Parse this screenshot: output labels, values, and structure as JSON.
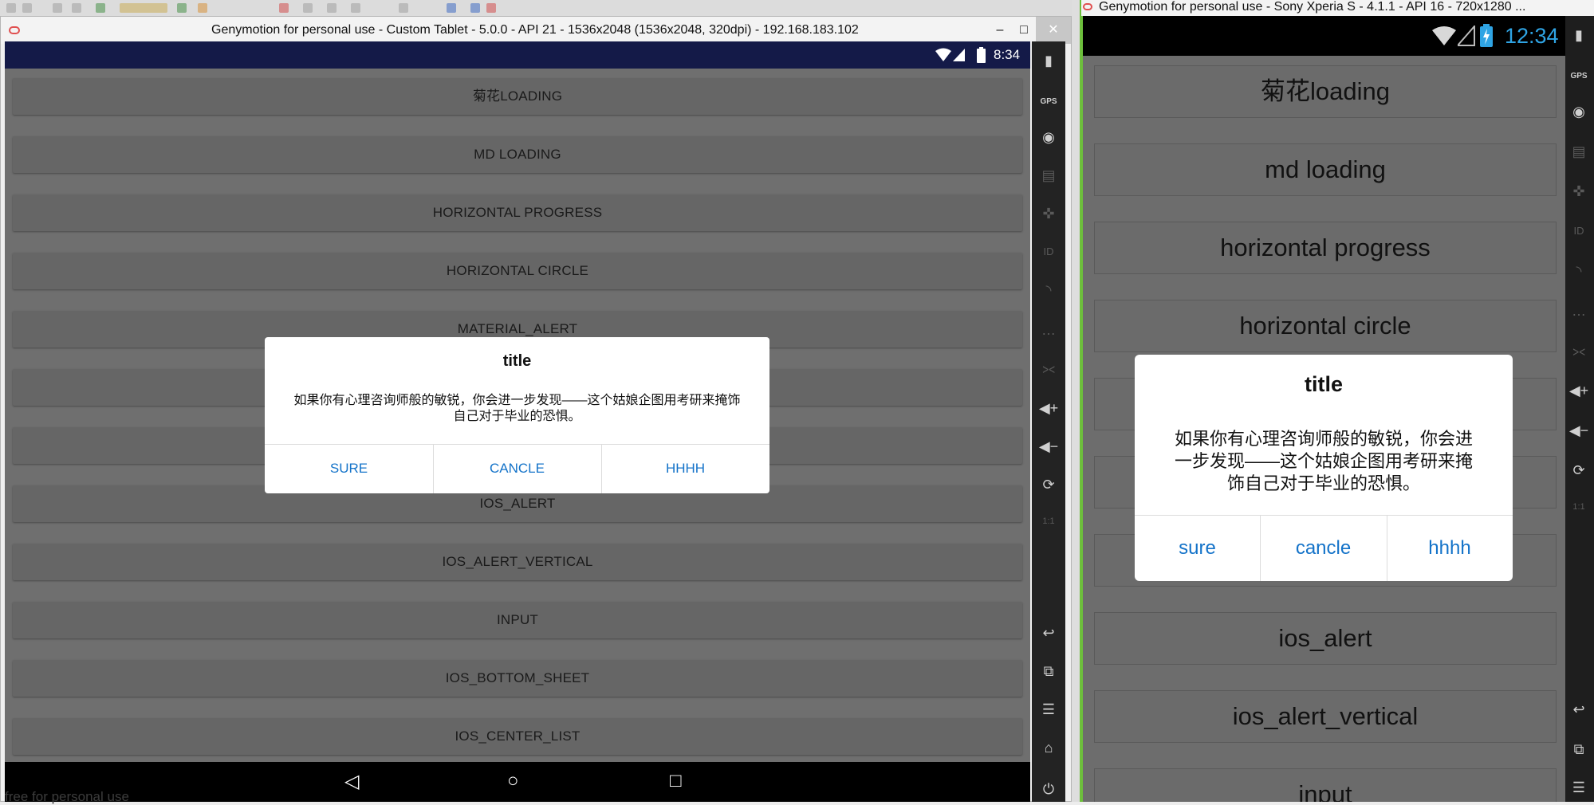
{
  "left_window": {
    "title": "Genymotion for personal use - Custom Tablet - 5.0.0 - API 21 - 1536x2048 (1536x2048, 320dpi) - 192.168.183.102",
    "controls": {
      "minimize": "–",
      "maximize": "□",
      "close": "✕"
    },
    "status_bar": {
      "time": "8:34"
    },
    "buttons": [
      "菊花LOADING",
      "MD LOADING",
      "HORIZONTAL PROGRESS",
      "HORIZONTAL CIRCLE",
      "MATERIAL_ALERT",
      "",
      "",
      "IOS_ALERT",
      "IOS_ALERT_VERTICAL",
      "INPUT",
      "IOS_BOTTOM_SHEET",
      "IOS_CENTER_LIST"
    ],
    "dialog": {
      "title": "title",
      "message": "如果你有心理咨询师般的敏锐，你会进一步发现——这个姑娘企图用考研来掩饰自己对于毕业的恐惧。",
      "buttons": [
        "SURE",
        "CANCLE",
        "HHHH"
      ]
    },
    "nav_bar": {
      "back": "◁",
      "home": "○",
      "recents": "□"
    },
    "watermark": "free for personal use"
  },
  "left_sidebar": {
    "icons": [
      {
        "name": "battery-icon",
        "glyph": "▮"
      },
      {
        "name": "gps-icon",
        "glyph": "GPS"
      },
      {
        "name": "camera-icon",
        "glyph": "◉"
      },
      {
        "name": "video-icon",
        "glyph": "▤"
      },
      {
        "name": "move-icon",
        "glyph": "✜"
      },
      {
        "name": "id-icon",
        "glyph": "ID"
      },
      {
        "name": "rss-icon",
        "glyph": "◝"
      },
      {
        "name": "sms-icon",
        "glyph": "…"
      },
      {
        "name": "share-icon",
        "glyph": "⪥"
      },
      {
        "name": "volume-up-icon",
        "glyph": "◀+"
      },
      {
        "name": "volume-down-icon",
        "glyph": "◀−"
      },
      {
        "name": "rotate-icon",
        "glyph": "⟳"
      },
      {
        "name": "scale-icon",
        "glyph": "1:1"
      },
      {
        "name": "back-icon",
        "glyph": "↩"
      },
      {
        "name": "recents-icon",
        "glyph": "⧉"
      },
      {
        "name": "menu-icon",
        "glyph": "☰"
      },
      {
        "name": "home-icon",
        "glyph": "⌂"
      },
      {
        "name": "power-icon",
        "glyph": "⏻"
      }
    ]
  },
  "right_window": {
    "title": "Genymotion for personal use - Sony Xperia S - 4.1.1 - API 16 - 720x1280 ...",
    "status_bar": {
      "time": "12:34"
    },
    "buttons": [
      "菊花loading",
      "md loading",
      "horizontal progress",
      "horizontal circle",
      "",
      "",
      "",
      "ios_alert",
      "ios_alert_vertical",
      "input"
    ],
    "dialog": {
      "title": "title",
      "message": "如果你有心理咨询师般的敏锐，你会进一步发现——这个姑娘企图用考研来掩饰自己对于毕业的恐惧。",
      "buttons": [
        "sure",
        "cancle",
        "hhhh"
      ]
    }
  },
  "colors": {
    "accent": "#1473c9",
    "status_bar_left": "#141a48",
    "window_border_right": "#6dbf3c"
  }
}
